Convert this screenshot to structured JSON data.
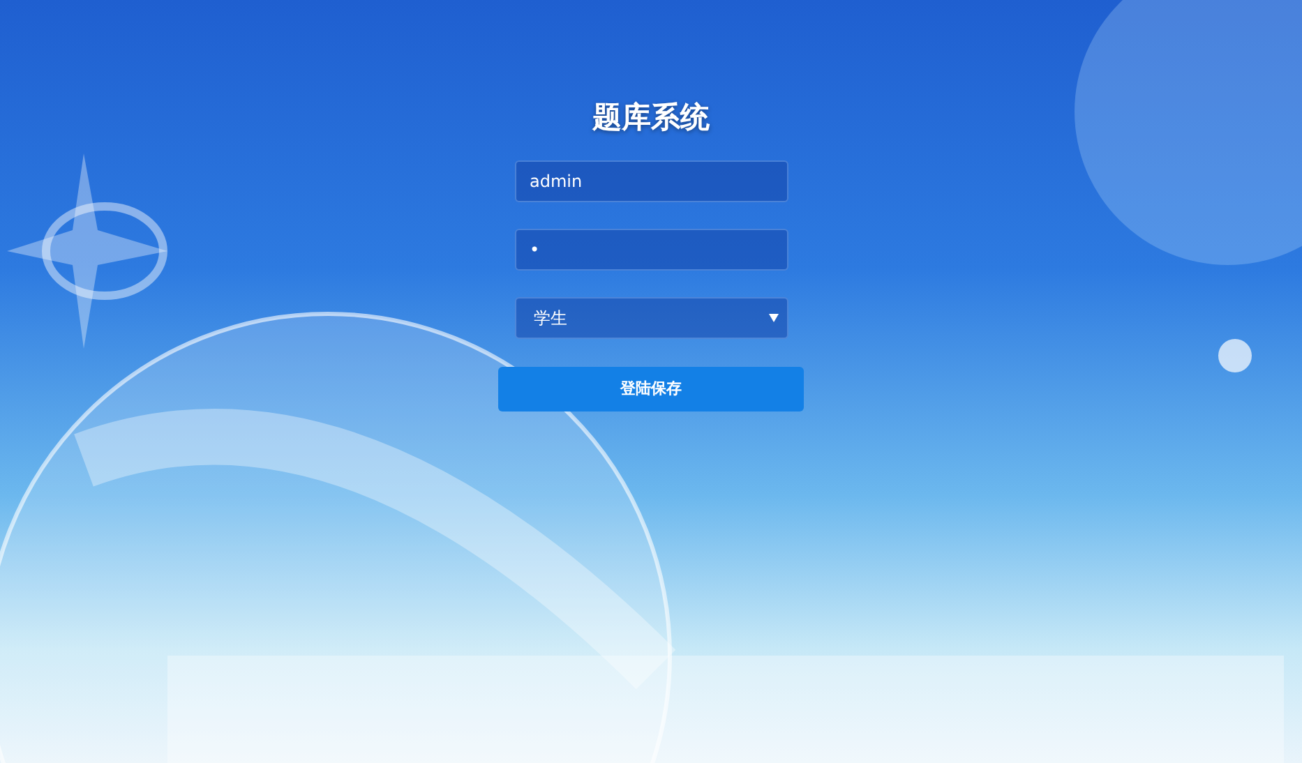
{
  "title": "题库系统",
  "username": {
    "value": "admin"
  },
  "password": {
    "value": "•"
  },
  "role": {
    "value": "学生"
  },
  "button": "登陆保存"
}
